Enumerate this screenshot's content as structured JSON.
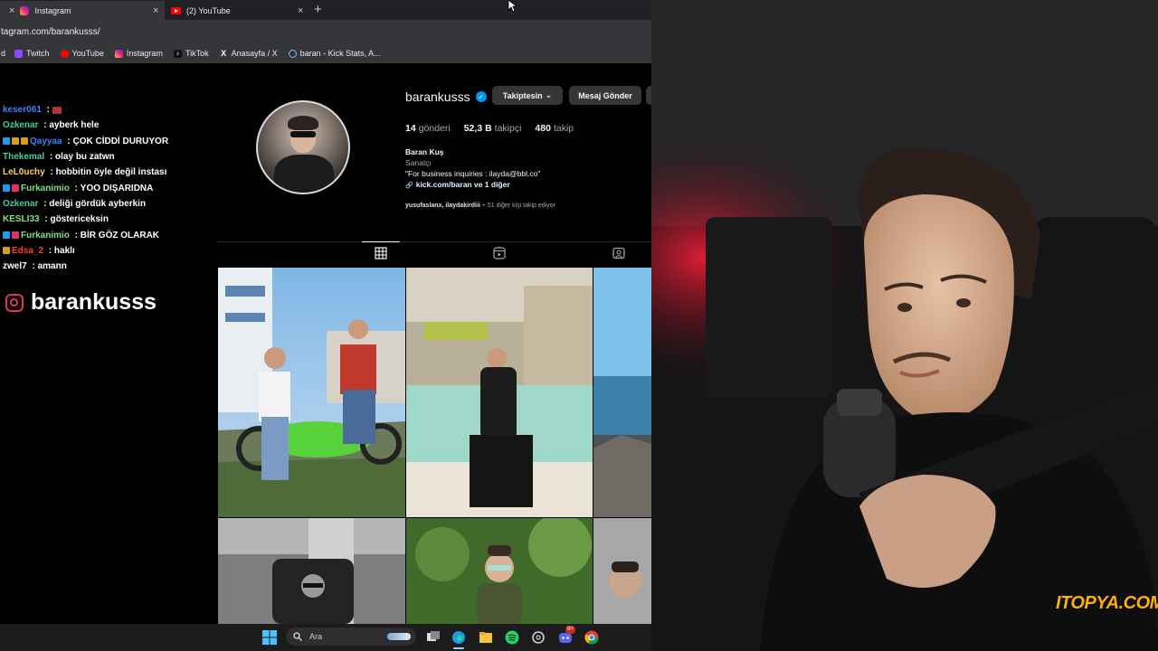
{
  "browser": {
    "tabs": [
      {
        "label": "Instagram",
        "active": true
      },
      {
        "label": "(2) YouTube",
        "active": false
      }
    ],
    "close_glyph": "×",
    "new_tab_glyph": "+",
    "url": "tagram.com/barankusss/",
    "bookmark_first_fragment": "d",
    "bookmarks": [
      {
        "label": "Twitch",
        "icon": "twitch-icon"
      },
      {
        "label": "YouTube",
        "icon": "youtube-icon"
      },
      {
        "label": "Instagram",
        "icon": "instagram-icon"
      },
      {
        "label": "TikTok",
        "icon": "tiktok-icon"
      },
      {
        "label": "Anasayfa / X",
        "icon": "x-icon"
      },
      {
        "label": "baran - Kick Stats, A...",
        "icon": "kick-stats-icon"
      }
    ]
  },
  "chat": {
    "messages": [
      {
        "user": "keser061",
        "sep": " : ",
        "text": "",
        "color": "#3b82f6",
        "badges": [
          "#b0323a"
        ],
        "trailing_badge": true
      },
      {
        "user": "Ozkenar",
        "sep": " : ",
        "text": "ayberk hele",
        "color": "#3fd0a3",
        "badges": []
      },
      {
        "user": "Qayyaa",
        "sep": " : ",
        "text": "ÇOK CİDDİ DURUYOR",
        "color": "#3b82f6",
        "badges": [
          "#1d9bf0",
          "#d4a017",
          "#d4a017"
        ]
      },
      {
        "user": "Thekemal",
        "sep": " : ",
        "text": "olay bu zatwn",
        "color": "#3fd0a3",
        "badges": []
      },
      {
        "user": "LeL0uchy",
        "sep": " : ",
        "text": "hobbitin öyle değil instası",
        "color": "#ffd24a",
        "badges": []
      },
      {
        "user": "Furkanimio",
        "sep": " : ",
        "text": "YOO DIŞARIDNA",
        "color": "#7fe07f",
        "badges": [
          "#1d9bf0",
          "#e1306c"
        ]
      },
      {
        "user": "Ozkenar",
        "sep": " : ",
        "text": "deliği gördük ayberkin",
        "color": "#3fd0a3",
        "badges": []
      },
      {
        "user": "KESLI33",
        "sep": " : ",
        "text": "göstericeksin",
        "color": "#7fe07f",
        "badges": []
      },
      {
        "user": "Furkanimio",
        "sep": " : ",
        "text": "BİR GÖZ OLARAK",
        "color": "#7fe07f",
        "badges": [
          "#1d9bf0",
          "#e1306c"
        ]
      },
      {
        "user": "Edsa_2",
        "sep": " : ",
        "text": "haklı",
        "color": "#ff3b30",
        "badges": [
          "#d4a017"
        ]
      },
      {
        "user": "zwel7",
        "sep": " : ",
        "text": "amann",
        "color": "#ffffff",
        "badges": []
      }
    ]
  },
  "overlay": {
    "handle": "barankusss",
    "icon": "instagram-icon"
  },
  "profile": {
    "username": "barankusss",
    "verified_glyph": "✓",
    "follow_button": "Takiptesin",
    "follow_chevron": "⌄",
    "message_button": "Mesaj Gönder",
    "stats": [
      {
        "num": "14",
        "label": "gönderi"
      },
      {
        "num": "52,3 B",
        "label": "takipçi"
      },
      {
        "num": "480",
        "label": "takip"
      }
    ],
    "name": "Baran Kuş",
    "category": "Sanatçı",
    "bio": "\"For business inquiries : ilayda@bbl.co\"",
    "link_glyph": "🔗",
    "link": "kick.com/baran ve 1 diğer",
    "followed_by_names": "yusufaslanx, ilaydakirdiii",
    "followed_by_rest": " + 51 diğer kişi takip ediyor",
    "tab_icons": [
      "grid-icon",
      "reels-icon",
      "tagged-icon"
    ]
  },
  "taskbar": {
    "search_placeholder": "Ara",
    "notification_badge": "9+",
    "icons": [
      "windows-start-icon",
      "search-icon",
      "task-view-icon",
      "edge-icon",
      "file-explorer-icon",
      "spotify-icon",
      "chatgpt-icon",
      "discord-icon",
      "chrome-icon"
    ]
  },
  "webcam": {
    "watermark": "ITOPYA.COM"
  },
  "colors": {
    "browser_tab_bg": "#202124",
    "browser_bar_bg": "#35363a",
    "instagram_bg": "#000000",
    "button_bg": "#363636",
    "verified": "#0095f6",
    "watermark": "#ffb000"
  }
}
